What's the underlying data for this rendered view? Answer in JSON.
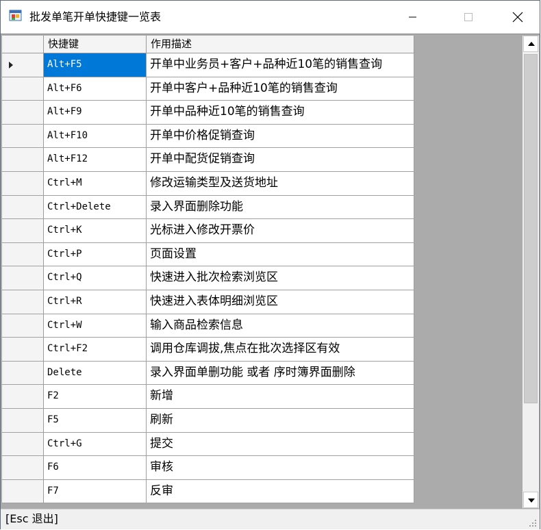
{
  "window": {
    "title": "批发单笔开单快捷键一览表"
  },
  "grid": {
    "headers": [
      "快捷键",
      "作用描述"
    ],
    "rows": [
      {
        "key": "Alt+F5",
        "desc": "开单中业务员+客户+品种近10笔的销售查询"
      },
      {
        "key": "Alt+F6",
        "desc": "开单中客户+品种近10笔的销售查询"
      },
      {
        "key": "Alt+F9",
        "desc": "开单中品种近10笔的销售查询"
      },
      {
        "key": "Alt+F10",
        "desc": "开单中价格促销查询"
      },
      {
        "key": "Alt+F12",
        "desc": "开单中配货促销查询"
      },
      {
        "key": "Ctrl+M",
        "desc": "修改运输类型及送货地址"
      },
      {
        "key": "Ctrl+Delete",
        "desc": "录入界面删除功能"
      },
      {
        "key": "Ctrl+K",
        "desc": "光标进入修改开票价"
      },
      {
        "key": "Ctrl+P",
        "desc": "页面设置"
      },
      {
        "key": "Ctrl+Q",
        "desc": "快速进入批次检索浏览区"
      },
      {
        "key": "Ctrl+R",
        "desc": "快速进入表体明细浏览区"
      },
      {
        "key": "Ctrl+W",
        "desc": "输入商品检索信息"
      },
      {
        "key": "Ctrl+F2",
        "desc": "调用仓库调拔,焦点在批次选择区有效"
      },
      {
        "key": "Delete",
        "desc": "录入界面单删功能 或者 序时簿界面删除"
      },
      {
        "key": "F2",
        "desc": "新增"
      },
      {
        "key": "F5",
        "desc": "刷新"
      },
      {
        "key": "Ctrl+G",
        "desc": "提交"
      },
      {
        "key": "F6",
        "desc": "审核"
      },
      {
        "key": "F7",
        "desc": "反审"
      }
    ],
    "selected_row": 0
  },
  "status": {
    "text": "[Esc 退出]"
  },
  "colors": {
    "selection": "#0078d7",
    "grid_background": "#ababab"
  }
}
